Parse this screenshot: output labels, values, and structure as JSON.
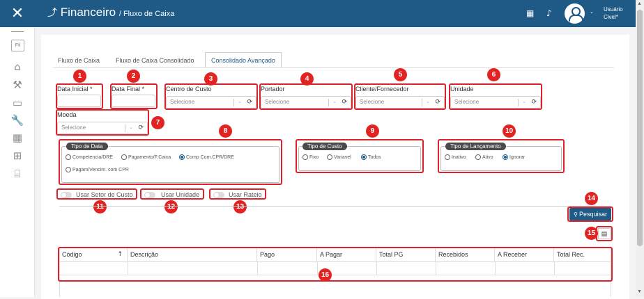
{
  "topbar": {
    "close_icon": "close-icon",
    "app_title": "Financeiro",
    "page_title": "/ Fluxo de Caixa",
    "user_line1": "Usuário",
    "user_line2": "Civel*"
  },
  "sidebar": {
    "fil_label": "Fil",
    "icons": [
      "home-icon",
      "hammer-icon",
      "archive-icon",
      "wrench-icon",
      "grid-icon",
      "sitemap-icon",
      "bank-icon"
    ]
  },
  "tabs": [
    {
      "label": "Fluxo de Caixa"
    },
    {
      "label": "Fluxo de Caixa Consolidado"
    },
    {
      "label": "Consolidado Avançado"
    }
  ],
  "filters": {
    "data_inicial": "Data Inicial *",
    "data_final": "Data Final *",
    "centro_custo": "Centro de Custo",
    "portador": "Portador",
    "cliente_fornecedor": "Cliente/Fornecedor",
    "unidade": "Unidade",
    "moeda": "Moeda",
    "placeholder": "Selecione"
  },
  "tipo_data": {
    "legend": "Tipo de Data",
    "options": [
      "Competencia/DRE",
      "Pagamento/F.Caixa",
      "Comp Com.CPR/DRE",
      "Pagam/Vencim. com CPR"
    ],
    "selected": 2
  },
  "tipo_custo": {
    "legend": "Tipo de Custo",
    "options": [
      "Fixo",
      "Variavel",
      "Todos"
    ],
    "selected": 2
  },
  "tipo_lancamento": {
    "legend": "Tipo de Lançamento",
    "options": [
      "Inativo",
      "Ativo",
      "Ignorar"
    ],
    "selected": 2
  },
  "toggles": {
    "setor": "Usar Setor de Custo",
    "unidade": "Usar Unidade",
    "rateio": "Usar Rateio"
  },
  "buttons": {
    "search": "Pesquisar"
  },
  "table": {
    "headers": [
      "Código",
      "Descrição",
      "Pago",
      "A Pagar",
      "Total PG",
      "Recebidos",
      "A Receber",
      "Total Rec."
    ],
    "sort_icon": "↑"
  },
  "badges": [
    "1",
    "2",
    "3",
    "4",
    "5",
    "6",
    "7",
    "8",
    "9",
    "10",
    "11",
    "12",
    "13",
    "14",
    "15",
    "16"
  ],
  "annotation_color": "#e32322",
  "brand_color": "#1e5a85"
}
